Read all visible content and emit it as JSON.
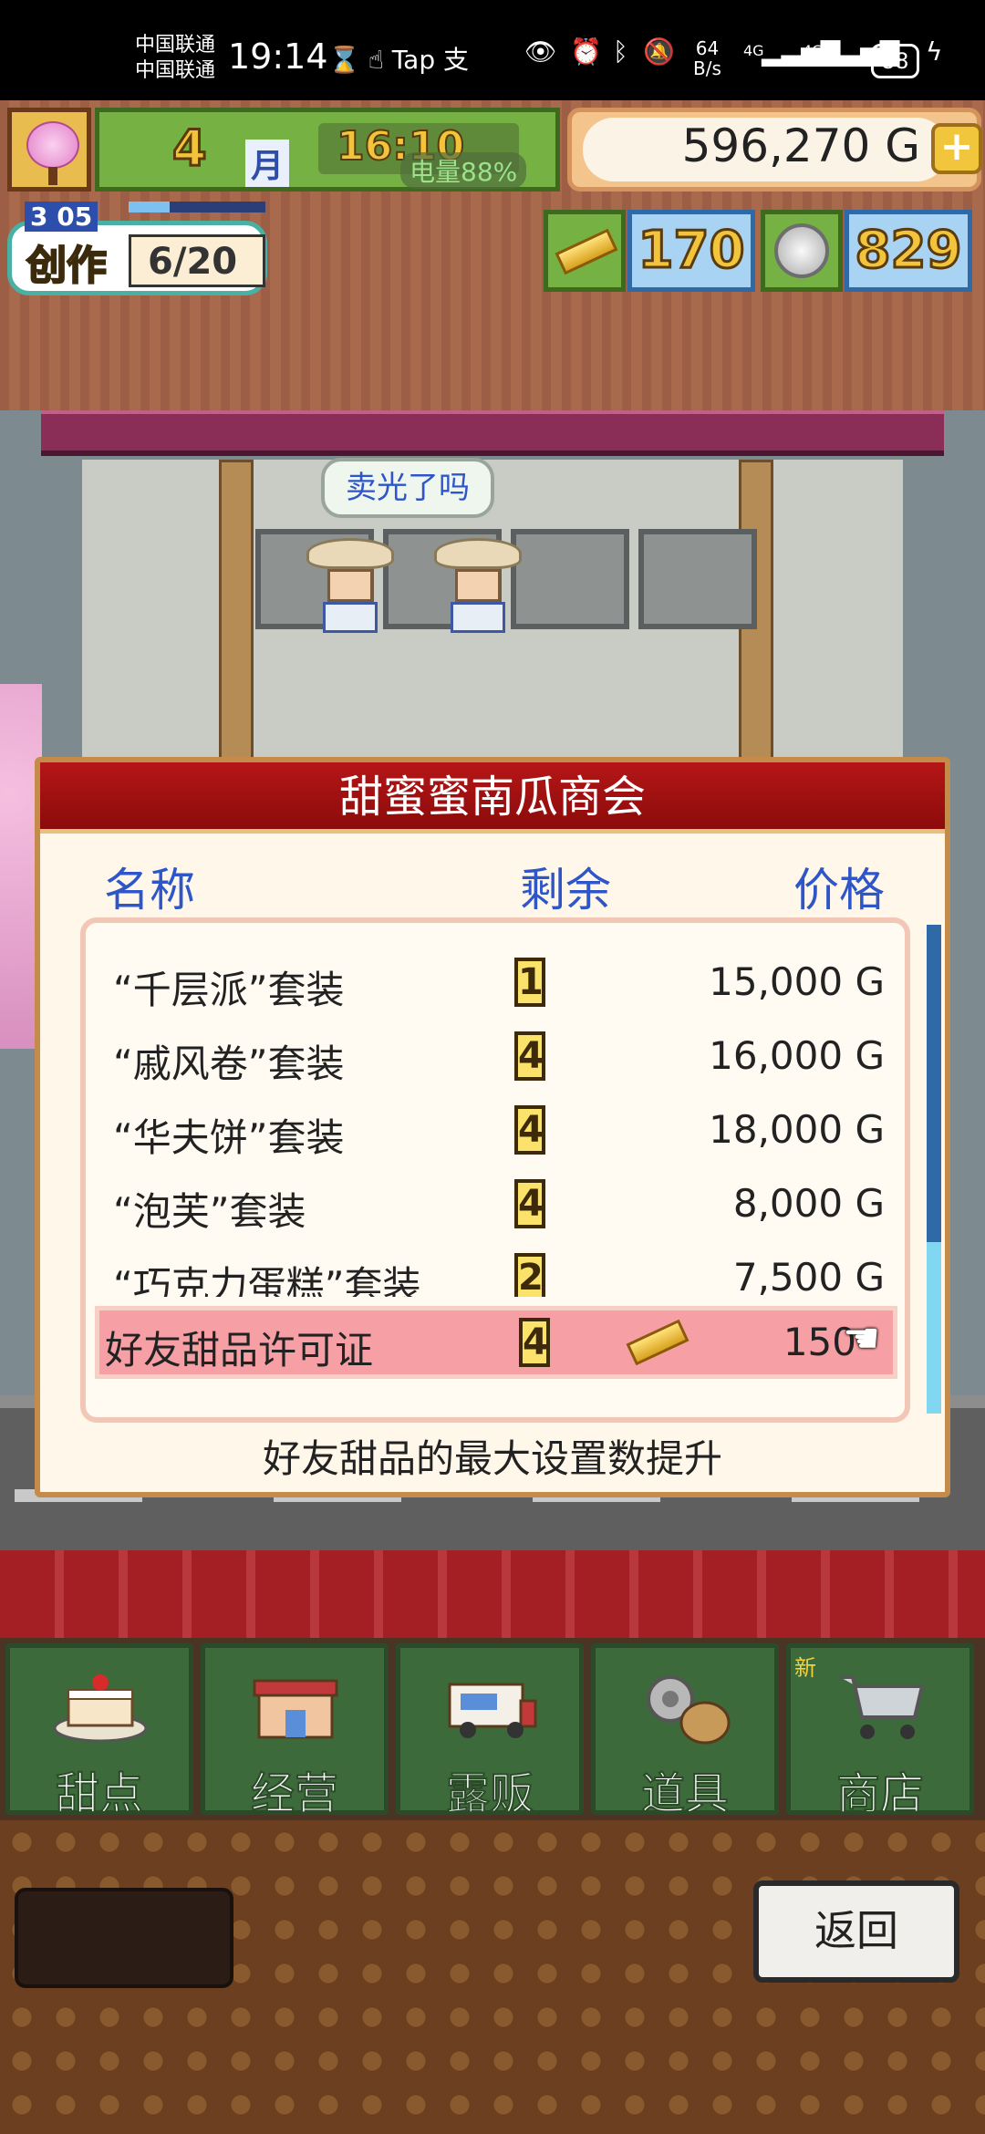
{
  "status_bar": {
    "carrier_1": "中国联通",
    "carrier_2": "中国联通",
    "time": "19:14",
    "icons_left": "⌛ ☝ Tap 支",
    "net_speed_value": "64",
    "net_speed_unit": "B/s",
    "signal_1": "4G",
    "signal_2": "4G",
    "battery": "88"
  },
  "hud": {
    "month_number": "4",
    "month_label": "月",
    "time": "16:10",
    "battery_tip": "电量88%",
    "money": "596,270 G",
    "plus_label": "+",
    "create_label": "创作",
    "level": "3 05",
    "create_progress": "6/20",
    "create_progress_fraction": 0.3,
    "gold_bars": "170",
    "silver_coins": "829"
  },
  "scene": {
    "speech_bubble": "卖光了吗"
  },
  "dialog": {
    "title": "甜蜜蜜南瓜商会",
    "col_name": "名称",
    "col_remaining": "剩余",
    "col_price": "价格",
    "items": [
      {
        "name": "“千层派”套装",
        "count": "1",
        "price": "15,000 G"
      },
      {
        "name": "“戚风卷”套装",
        "count": "4",
        "price": "16,000 G"
      },
      {
        "name": "“华夫饼”套装",
        "count": "4",
        "price": "18,000 G"
      },
      {
        "name": "“泡芙”套装",
        "count": "4",
        "price": "8,000 G"
      },
      {
        "name": "“巧克力蛋糕”套装",
        "count": "2",
        "price": "7,500 G"
      }
    ],
    "selected_item": {
      "name": "好友甜品许可证",
      "count": "4",
      "price": "150",
      "currency_icon": "gold-bar-icon"
    },
    "description": "好友甜品的最大设置数提升",
    "scroll_fraction": 0.65
  },
  "tabs": [
    {
      "label": "甜点",
      "icon": "cake-icon"
    },
    {
      "label": "经营",
      "icon": "shop-icon"
    },
    {
      "label": "露贩",
      "icon": "food-truck-icon"
    },
    {
      "label": "道具",
      "icon": "gear-bag-icon"
    },
    {
      "label": "商店",
      "icon": "cart-icon",
      "badge": "新"
    }
  ],
  "back_button": "返回",
  "colors": {
    "title_red": "#b51617",
    "header_blue": "#2e56c8",
    "selected_row": "#f6a0a5",
    "tab_green": "#3c6a3a"
  }
}
